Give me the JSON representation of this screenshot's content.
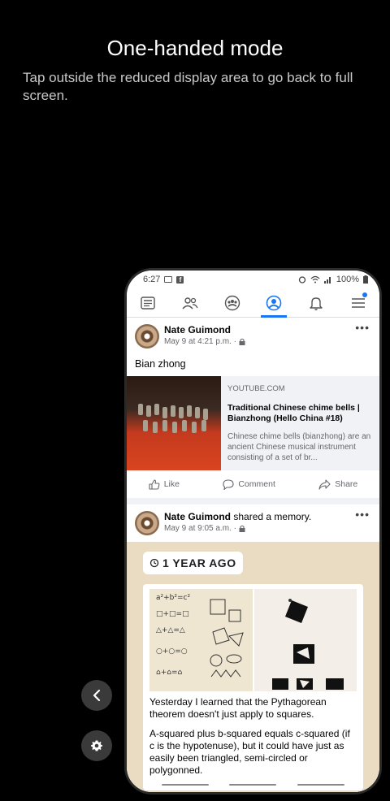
{
  "overlay": {
    "title": "One-handed mode",
    "description": "Tap outside the reduced display area to go back to full screen."
  },
  "status_bar": {
    "time": "6:27",
    "battery": "100%"
  },
  "navbar": {
    "items": [
      "news-feed-icon",
      "friends-icon",
      "groups-icon",
      "profile-icon",
      "bell-icon",
      "menu-icon"
    ],
    "active": "profile-icon",
    "accent": "#1877f2"
  },
  "post1": {
    "author": "Nate Guimond",
    "meta": "May 9 at 4:21 p.m. ·",
    "text": "Bian zhong",
    "link": {
      "source": "YOUTUBE.COM",
      "title": "Traditional Chinese chime bells | Bianzhong (Hello China #18)",
      "description": "Chinese chime bells (bianzhong) are an ancient Chinese musical instrument consisting of a set of br..."
    },
    "actions": {
      "like": "Like",
      "comment": "Comment",
      "share": "Share"
    }
  },
  "post2": {
    "author": "Nate Guimond",
    "action_text": "shared a memory.",
    "meta": "May 9 at 9:05 a.m. ·",
    "badge": "1 YEAR AGO",
    "memory_p1": "Yesterday I learned that the Pythagorean theorem doesn't just apply to squares.",
    "memory_p2": "A-squared plus b-squared equals c-squared (if c is the hypotenuse), but it could have just as easily been triangled, semi-circled or polygonned."
  }
}
